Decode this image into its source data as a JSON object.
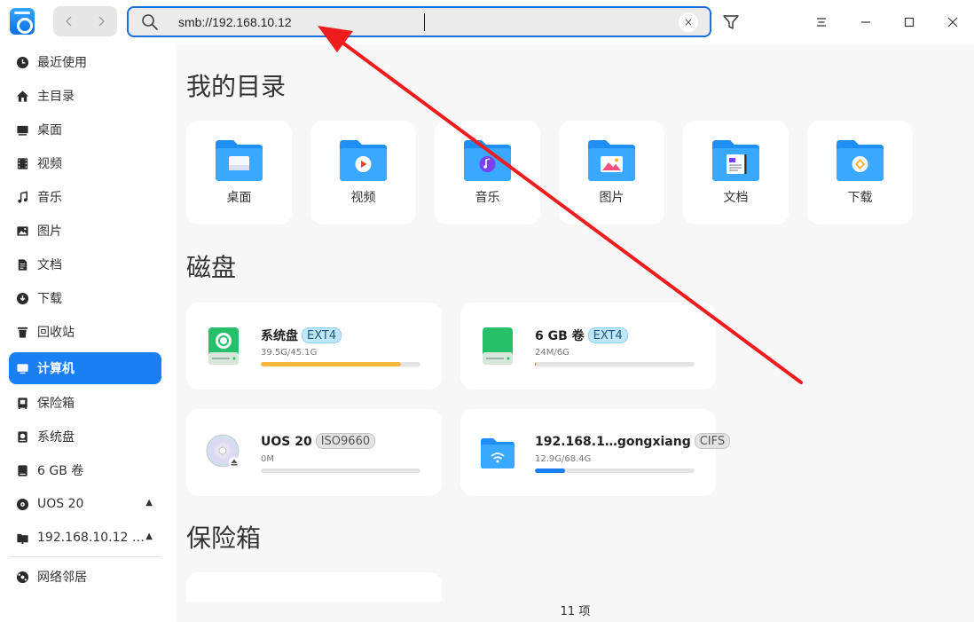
{
  "toolbar": {
    "address_value": "smb://192.168.10.12",
    "clear_label": "×"
  },
  "sidebar": {
    "items": [
      {
        "label": "最近使用",
        "icon": "clock-icon"
      },
      {
        "label": "主目录",
        "icon": "home-icon"
      },
      {
        "label": "桌面",
        "icon": "desktop-icon"
      },
      {
        "label": "视频",
        "icon": "video-icon"
      },
      {
        "label": "音乐",
        "icon": "music-icon"
      },
      {
        "label": "图片",
        "icon": "picture-icon"
      },
      {
        "label": "文档",
        "icon": "document-icon"
      },
      {
        "label": "下载",
        "icon": "download-icon"
      },
      {
        "label": "回收站",
        "icon": "trash-icon"
      },
      {
        "label": "计算机",
        "icon": "computer-icon",
        "active": true
      },
      {
        "label": "保险箱",
        "icon": "vault-icon"
      },
      {
        "label": "系统盘",
        "icon": "system-disk-icon"
      },
      {
        "label": "6 GB 卷",
        "icon": "disk-icon"
      },
      {
        "label": "UOS 20",
        "icon": "cdrom-icon",
        "eject": true
      },
      {
        "label": "192.168.10.12 …",
        "icon": "network-folder-icon",
        "eject": true
      },
      {
        "label": "网络邻居",
        "icon": "network-icon"
      }
    ],
    "eject_glyph": "▲"
  },
  "main": {
    "my_dirs_title": "我的目录",
    "folders": [
      {
        "label": "桌面",
        "icon": "desktop-folder-icon"
      },
      {
        "label": "视频",
        "icon": "video-folder-icon"
      },
      {
        "label": "音乐",
        "icon": "music-folder-icon"
      },
      {
        "label": "图片",
        "icon": "picture-folder-icon"
      },
      {
        "label": "文档",
        "icon": "document-folder-icon"
      },
      {
        "label": "下载",
        "icon": "download-folder-icon"
      }
    ],
    "disks_title": "磁盘",
    "disks": [
      {
        "name": "系统盘",
        "fs": "EXT4",
        "usage": "39.5G/45.1G",
        "fill": 0.876,
        "bar_color": "#f6b73c"
      },
      {
        "name": "6 GB 卷",
        "fs": "EXT4",
        "usage": "24M/6G",
        "fill": 0.004,
        "bar_color": "#1a7ff2"
      },
      {
        "name": "UOS 20",
        "fs": "ISO9660",
        "usage": "0M",
        "fill": 0,
        "bar_color": "#1a7ff2"
      },
      {
        "name": "192.168.1…gongxiang",
        "fs": "CIFS",
        "usage": "12.9G/68.4G",
        "fill": 0.189,
        "bar_color": "#1a7ff2"
      }
    ],
    "vault_title": "保险箱"
  },
  "status": {
    "count": "11 项"
  },
  "colors": {
    "accent": "#1a7ff2",
    "annotation": "#ee1c1c"
  }
}
